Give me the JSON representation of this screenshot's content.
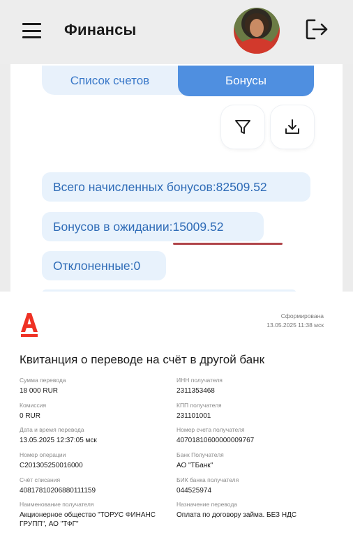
{
  "app": {
    "title": "Финансы",
    "tabs": [
      {
        "label": "Список счетов",
        "active": false
      },
      {
        "label": "Бонусы",
        "active": true
      }
    ],
    "icons": {
      "menu": "hamburger-icon",
      "logout": "logout-icon",
      "filter": "filter-icon",
      "download": "download-icon"
    },
    "stats": {
      "total": "Всего начисленных бонусов:82509.52",
      "pending": "Бонусов в ожидании:15009.52",
      "rejected": "Отклоненные:0"
    },
    "colors": {
      "accent": "#4f8fe0",
      "stat_bg": "#e8f2fc",
      "stat_text": "#2f6cb7",
      "underline": "#b0454a"
    }
  },
  "receipt": {
    "logo_icon": "bank-a-logo-icon",
    "logo_color": "#ef3124",
    "formed_label": "Сформирована",
    "formed_date": "13.05.2025 11:38 мск",
    "title": "Квитанция о переводе на счёт в другой банк",
    "left_fields": [
      {
        "label": "Сумма перевода",
        "value": "18 000 RUR"
      },
      {
        "label": "Комиссия",
        "value": "0 RUR"
      },
      {
        "label": "Дата и время перевода",
        "value": "13.05.2025 12:37:05 мск"
      },
      {
        "label": "Номер операции",
        "value": "C201305250016000"
      },
      {
        "label": "Счёт списания",
        "value": "40817810206880111159"
      },
      {
        "label": "Наименование получателя",
        "value": "Акционерное общество \"ТОРУС ФИНАНС ГРУПП\", АО \"ТФГ\""
      }
    ],
    "right_fields": [
      {
        "label": "ИНН получателя",
        "value": "2311353468"
      },
      {
        "label": "КПП получателя",
        "value": "231101001"
      },
      {
        "label": "Номер счета получателя",
        "value": "40701810600000009767"
      },
      {
        "label": "Банк Получателя",
        "value": "АО \"ТБанк\""
      },
      {
        "label": "БИК банка получателя",
        "value": "044525974"
      },
      {
        "label": "Назначение перевода",
        "value": "Оплата по договору займа. БЕЗ НДС"
      }
    ]
  }
}
